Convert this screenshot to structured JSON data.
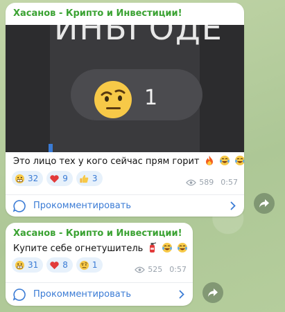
{
  "posts": [
    {
      "author": "Хасанов - Крипто и Инвестиции!",
      "media": {
        "top_text": "ИНЬГОДЕ",
        "count": "1"
      },
      "text": "Это лицо тех у кого сейчас прям горит",
      "reactions": [
        {
          "icon": "grimace-emoji",
          "count": "32"
        },
        {
          "icon": "red-heart-emoji",
          "count": "9"
        },
        {
          "icon": "thumbs-up-emoji",
          "count": "3"
        }
      ],
      "views": "589",
      "time": "0:57",
      "comment_label": "Прокомментировать"
    },
    {
      "author": "Хасанов - Крипто и Инвестиции!",
      "text": "Купите себе огнетушитель",
      "reactions": [
        {
          "icon": "grimace-emoji",
          "count": "31"
        },
        {
          "icon": "red-heart-emoji",
          "count": "8"
        },
        {
          "icon": "raised-eyebrow-emoji",
          "count": "1"
        }
      ],
      "views": "525",
      "time": "0:57",
      "comment_label": "Прокомментировать"
    }
  ],
  "colors": {
    "author": "#3aa232",
    "accent": "#3a7bd5",
    "reaction_bg": "#e7f1fb"
  }
}
